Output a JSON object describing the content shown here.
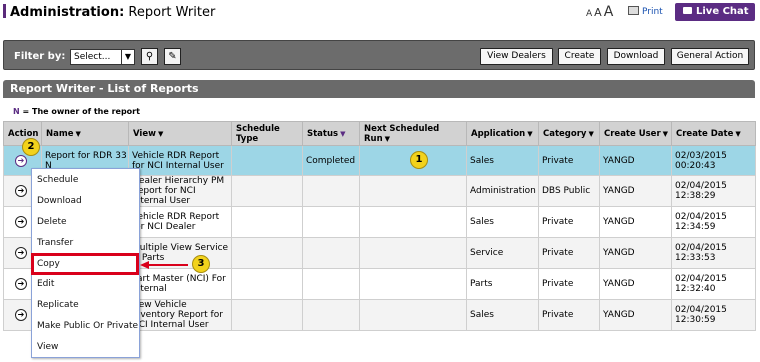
{
  "header": {
    "section": "Administration:",
    "page": "Report Writer",
    "font_sizes": [
      "A",
      "A",
      "A"
    ],
    "print_label": "Print",
    "live_chat_label": "Live Chat"
  },
  "toolbar": {
    "filter_label": "Filter by:",
    "filter_value": "Select...",
    "buttons": [
      "View Dealers",
      "Create",
      "Download",
      "General Action"
    ]
  },
  "panel": {
    "title": "Report Writer - List of Reports",
    "owner_marker": "N",
    "owner_note": "= The owner of the report"
  },
  "table": {
    "columns": [
      "Action",
      "Name",
      "View",
      "Schedule Type",
      "Status",
      "Next Scheduled Run",
      "Application",
      "Category",
      "Create User",
      "Create Date"
    ],
    "rows": [
      {
        "name": "Report for RDR 33 N",
        "view": "Vehicle RDR Report for NCI Internal User",
        "schedule": "",
        "status": "Completed",
        "next_run": "",
        "application": "Sales",
        "category": "Private",
        "user": "YANGD",
        "date": "02/03/2015 00:20:43"
      },
      {
        "name": "",
        "view": "Dealer Hierarchy PM Report for NCI Internal User",
        "schedule": "",
        "status": "",
        "next_run": "",
        "application": "Administration",
        "category": "DBS Public",
        "user": "YANGD",
        "date": "02/04/2015 12:38:29"
      },
      {
        "name": "",
        "view": "Vehicle RDR Report for NCI Dealer",
        "schedule": "",
        "status": "",
        "next_run": "",
        "application": "Sales",
        "category": "Private",
        "user": "YANGD",
        "date": "02/04/2015 12:34:59"
      },
      {
        "name": "",
        "view": "Multiple View Service & Parts",
        "schedule": "",
        "status": "",
        "next_run": "",
        "application": "Service",
        "category": "Private",
        "user": "YANGD",
        "date": "02/04/2015 12:33:53"
      },
      {
        "name": "",
        "view": "Part Master (NCI) For Internal",
        "schedule": "",
        "status": "",
        "next_run": "",
        "application": "Parts",
        "category": "Private",
        "user": "YANGD",
        "date": "02/04/2015 12:32:40"
      },
      {
        "name": "",
        "view": "New Vehicle Inventory Report for NCI Internal User",
        "schedule": "",
        "status": "",
        "next_run": "",
        "application": "Sales",
        "category": "Private",
        "user": "YANGD",
        "date": "02/04/2015 12:30:59"
      }
    ]
  },
  "context_menu": {
    "items": [
      "Schedule",
      "Download",
      "Delete",
      "Transfer",
      "Copy",
      "Edit",
      "Replicate",
      "Make Public Or Private",
      "View"
    ]
  },
  "callouts": [
    "1",
    "2",
    "3"
  ]
}
